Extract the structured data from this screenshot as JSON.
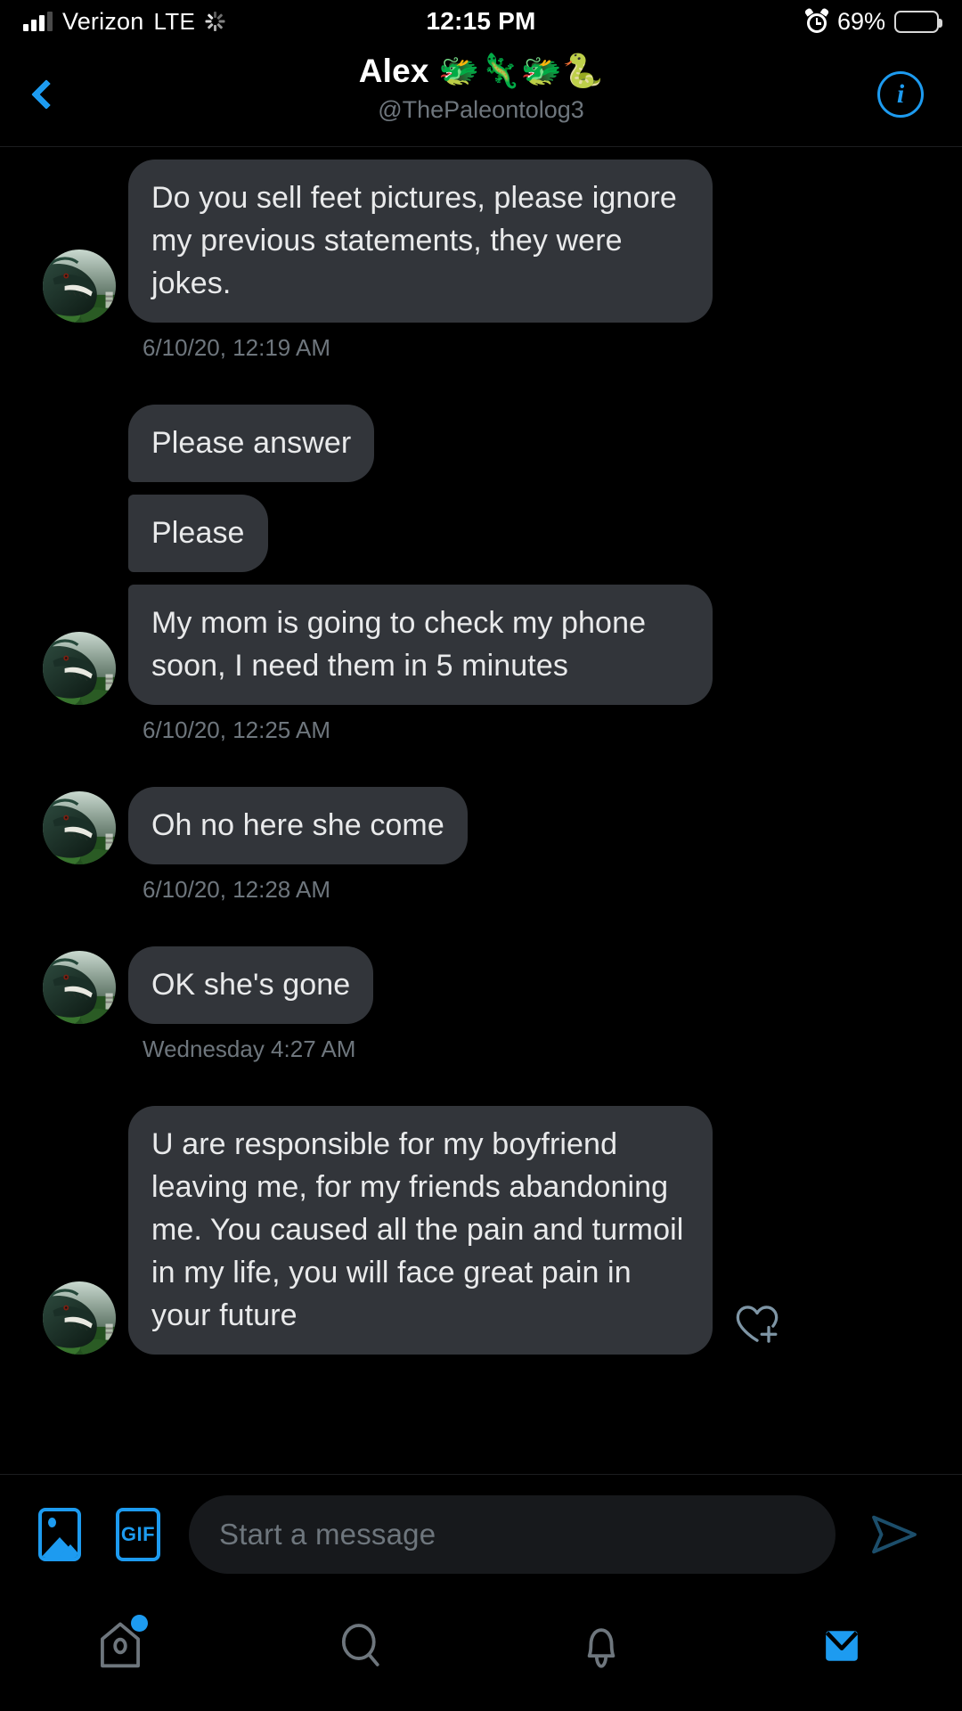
{
  "status_bar": {
    "carrier": "Verizon",
    "network": "LTE",
    "time": "12:15 PM",
    "battery_percent": "69%",
    "battery_level": 69,
    "signal_bars_filled": 3,
    "signal_bars_total": 4,
    "icons": [
      "signal-bars-icon",
      "activity-spinner-icon",
      "alarm-clock-icon",
      "battery-icon"
    ]
  },
  "header": {
    "back_icon": "chevron-left-icon",
    "title": "Alex 🐲🦎🐲🐍",
    "handle": "@ThePaleontolog3",
    "info_icon": "info-circle-icon",
    "accent_color": "#1d9bf0"
  },
  "thread": {
    "bubble_color": "#32353a",
    "text_color": "#e9eaeb",
    "timestamp_color": "#6e767d",
    "groups": [
      {
        "messages": [
          {
            "text": "Do you sell feet pictures, please ignore my previous statements, they were jokes.",
            "shape": "solo"
          }
        ],
        "timestamp": "6/10/20, 12:19 AM"
      },
      {
        "messages": [
          {
            "text": "Please answer",
            "shape": "top"
          },
          {
            "text": "Please",
            "shape": "mid"
          },
          {
            "text": "My mom is going to check my phone soon, I need them in 5 minutes",
            "shape": "bottom"
          }
        ],
        "timestamp": "6/10/20, 12:25 AM"
      },
      {
        "messages": [
          {
            "text": "Oh no here she come",
            "shape": "solo"
          }
        ],
        "timestamp": "6/10/20, 12:28 AM"
      },
      {
        "messages": [
          {
            "text": "OK she's gone",
            "shape": "solo"
          }
        ],
        "timestamp": "Wednesday 4:27 AM"
      },
      {
        "messages": [
          {
            "text": "U are responsible for my boyfriend leaving me, for my friends abandoning me. You caused all the pain and turmoil in my life, you will face great pain in your future",
            "shape": "solo",
            "reaction_icon": "heart-plus-icon"
          }
        ],
        "timestamp": ""
      }
    ]
  },
  "composer": {
    "image_icon": "image-icon",
    "gif_icon": "gif-icon",
    "gif_label": "GIF",
    "placeholder": "Start a message",
    "value": "",
    "send_icon": "send-arrow-icon"
  },
  "bottom_nav": {
    "items": [
      {
        "name": "home",
        "icon": "home-birdhouse-icon",
        "active": false,
        "badge": true
      },
      {
        "name": "search",
        "icon": "search-icon",
        "active": false,
        "badge": false
      },
      {
        "name": "notifications",
        "icon": "bell-icon",
        "active": false,
        "badge": false
      },
      {
        "name": "messages",
        "icon": "envelope-icon",
        "active": true,
        "badge": false
      }
    ],
    "active_color": "#1d9bf0",
    "inactive_color": "#6e767d"
  }
}
